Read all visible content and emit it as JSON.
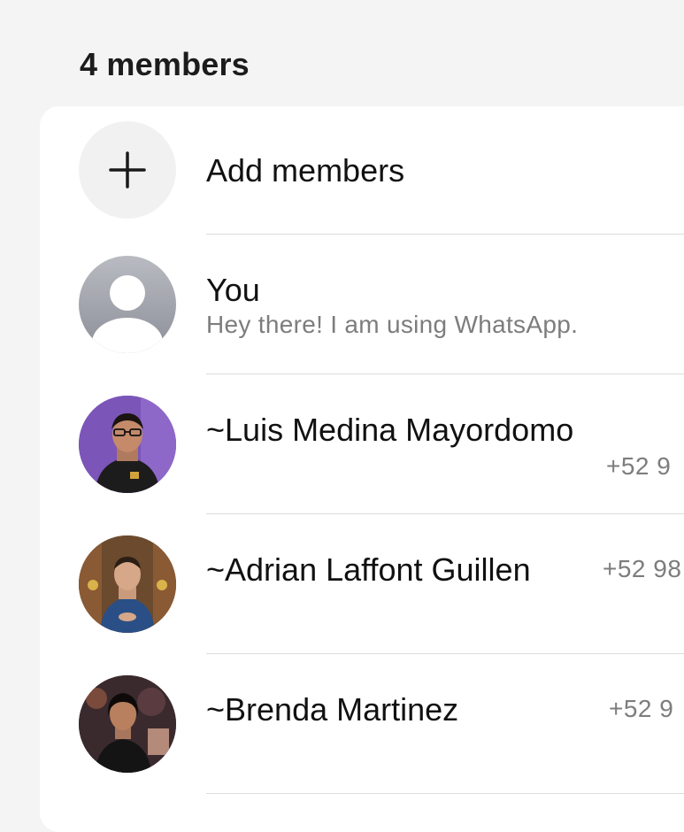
{
  "header": {
    "title": "4 members"
  },
  "add_members": {
    "label": "Add members",
    "icon": "plus-icon"
  },
  "members": [
    {
      "name": "You",
      "status": "Hey there! I am using WhatsApp.",
      "phone": "",
      "avatar": "default-person-icon"
    },
    {
      "name": "~Luis Medina Mayordomo",
      "status": "",
      "phone": "+52 9",
      "avatar": "photo",
      "avatar_bg": "#7b55b8"
    },
    {
      "name": "~Adrian Laffont Guillen",
      "status": "",
      "phone": "+52 98",
      "avatar": "photo",
      "avatar_bg": "#6b4a2e"
    },
    {
      "name": "~Brenda Martinez",
      "status": "",
      "phone": "+52 9",
      "avatar": "photo",
      "avatar_bg": "#3a2a2e"
    }
  ]
}
